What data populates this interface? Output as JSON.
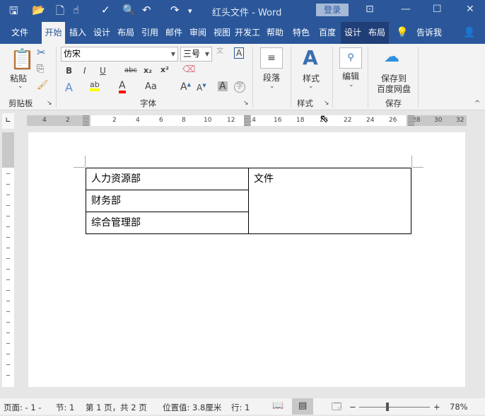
{
  "titlebar": {
    "title": "红头文件  -  Word",
    "login": "登录",
    "quick_access": [
      "save-icon",
      "open-icon",
      "new-icon",
      "touch-icon",
      "spelling-icon",
      "print-preview-icon",
      "undo-icon",
      "redo-icon",
      "customize-icon"
    ]
  },
  "tabs": [
    "文件",
    "开始",
    "插入",
    "设计",
    "布局",
    "引用",
    "邮件",
    "审阅",
    "视图",
    "开发工",
    "帮助",
    "特色功",
    "百度网",
    "设计",
    "布局"
  ],
  "tell_me": "告诉我",
  "ribbon": {
    "clipboard": {
      "paste": "粘贴",
      "label": "剪贴板"
    },
    "font": {
      "font_name": "仿宋",
      "font_size": "三号",
      "label": "字体",
      "bold": "B",
      "italic": "I",
      "underline": "U",
      "strike": "abc",
      "sub": "x₂",
      "sup": "x²",
      "case": "Aa",
      "highlight_color": "#ffff00",
      "font_color": "#ff0000"
    },
    "paragraph": {
      "label": "段落"
    },
    "styles": {
      "button": "样式",
      "label": "样式"
    },
    "editing": {
      "button": "编辑"
    },
    "save": {
      "button_line1": "保存到",
      "button_line2": "百度网盘",
      "label": "保存"
    }
  },
  "ruler": {
    "labels": [
      "4",
      "2",
      "2",
      "4",
      "6",
      "8",
      "10",
      "12",
      "14",
      "16",
      "18",
      "20",
      "22",
      "24",
      "26",
      "28",
      "30",
      "32"
    ]
  },
  "document": {
    "table": {
      "left_cells": [
        "人力资源部",
        "财务部",
        "综合管理部"
      ],
      "right_cell": "文件"
    }
  },
  "status": {
    "page": "页面: - 1 -",
    "section": "节: 1",
    "page_of": "第 1 页，共 2 页",
    "position": "位置值: 3.8厘米",
    "line": "行: 1",
    "zoom": "78%"
  },
  "colors": {
    "brand": "#2b579a"
  }
}
